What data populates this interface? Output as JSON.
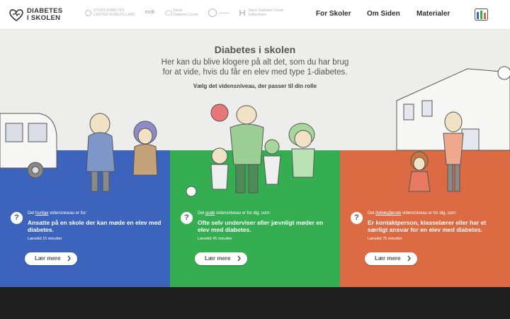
{
  "logo": {
    "line1": "DIABETES",
    "line2": "I SKOLEN"
  },
  "partners": [
    {
      "line1": "STENO DIABETES",
      "line2": "CENTER NORDJYLLAND"
    },
    {
      "line1": "mıdt",
      "line2": ""
    },
    {
      "line1": "Steno",
      "line2": "Diabetes Center"
    },
    {
      "line1": "",
      "line2": ""
    },
    {
      "line1": "Steno Diabetes Center",
      "line2": "København"
    }
  ],
  "nav": {
    "skoler": "For Skoler",
    "om": "Om Siden",
    "materialer": "Materialer"
  },
  "hero": {
    "title": "Diabetes i skolen",
    "subtitle": "Her kan du blive klogere på alt det, som du har brug for at vide, hvis du får en elev med type 1-diabetes.",
    "choose": "Vælg det vidensniveau, der passer til din rolle"
  },
  "panels": [
    {
      "color": "#3c64bd",
      "intro_pre": "Det ",
      "level": "hurtige",
      "intro_post": " vidensniveau er for:",
      "heading": "Ansatte på en skole der kan møde en elev med diabetes.",
      "readtime": "Læsetid 15 minutter",
      "button": "Lær mere"
    },
    {
      "color": "#35ae52",
      "intro_pre": "Det ",
      "level": "gode",
      "intro_post": " vidensniveau er for dig, som:",
      "heading": "Ofte selv underviser eller jævnligt møder en elev med diabetes.",
      "readtime": "Læsetid 45 minutter",
      "button": "Lær mere"
    },
    {
      "color": "#dc6a43",
      "intro_pre": "Det ",
      "level": "dybdegående",
      "intro_post": " vidensniveau er for dig, som:",
      "heading": "Er kontaktperson, klasselærer eller har et særligt ansvar for en elev med diabetes.",
      "readtime": "Læsetid 75 minutter",
      "button": "Lær mere"
    }
  ],
  "menu_icon": "menu-bars-icon"
}
